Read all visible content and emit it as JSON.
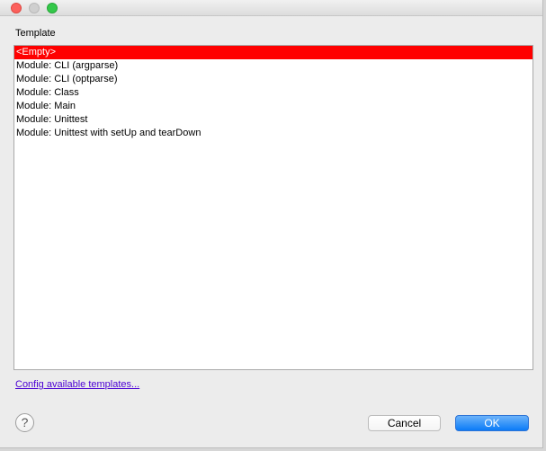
{
  "dialog": {
    "section_label": "Template",
    "templates": [
      "<Empty>",
      "Module: CLI (argparse)",
      "Module: CLI (optparse)",
      "Module: Class",
      "Module: Main",
      "Module: Unittest",
      "Module: Unittest with setUp and tearDown"
    ],
    "selected_index": 0,
    "selection_color": "#ff0000",
    "config_link": "Config available templates...",
    "help_glyph": "?",
    "help_icon": "question-mark-icon",
    "cancel_label": "Cancel",
    "ok_label": "OK",
    "accent_color": "#0b7bf7"
  }
}
